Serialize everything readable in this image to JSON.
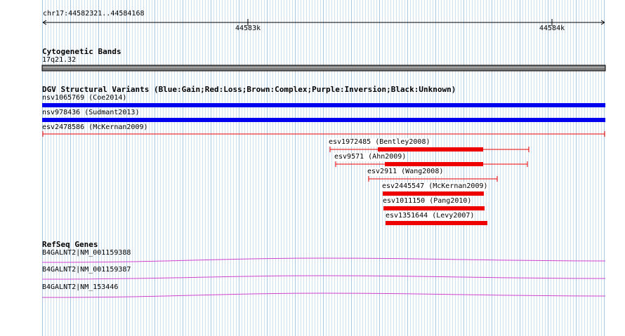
{
  "ruler": {
    "location": "chr17:44582321..44584168",
    "ticks": [
      {
        "label": "44583k"
      },
      {
        "label": "44584k"
      }
    ]
  },
  "cytogenetic": {
    "title": "Cytogenetic Bands",
    "band": "17q21.32"
  },
  "dgv": {
    "title": "DGV Structural Variants (Blue:Gain;Red:Loss;Brown:Complex;Purple:Inversion;Black:Unknown)",
    "variants": [
      {
        "label": "nsv1065769 (Coe2014)",
        "type": "gain",
        "color": "#0000ee"
      },
      {
        "label": "nsv978436 (Sudmant2013)",
        "type": "gain",
        "color": "#0000ee"
      },
      {
        "label": "esv2478586 (McKernan2009)",
        "type": "loss",
        "color": "#ee0000"
      },
      {
        "label": "esv1972485 (Bentley2008)",
        "type": "loss",
        "color": "#ee0000"
      },
      {
        "label": "esv9571 (Ahn2009)",
        "type": "loss",
        "color": "#ee0000"
      },
      {
        "label": "esv2911 (Wang2008)",
        "type": "loss",
        "color": "#ee0000"
      },
      {
        "label": "esv2445547 (McKernan2009)",
        "type": "loss",
        "color": "#ee0000"
      },
      {
        "label": "esv1011150 (Pang2010)",
        "type": "loss",
        "color": "#ee0000"
      },
      {
        "label": "esv1351644 (Levy2007)",
        "type": "loss",
        "color": "#ee0000"
      }
    ]
  },
  "refseq": {
    "title": "RefSeq Genes",
    "color": "#cc44cc",
    "genes": [
      {
        "label": "B4GALNT2|NM_001159388"
      },
      {
        "label": "B4GALNT2|NM_001159387"
      },
      {
        "label": "B4GALNT2|NM_153446"
      }
    ]
  }
}
